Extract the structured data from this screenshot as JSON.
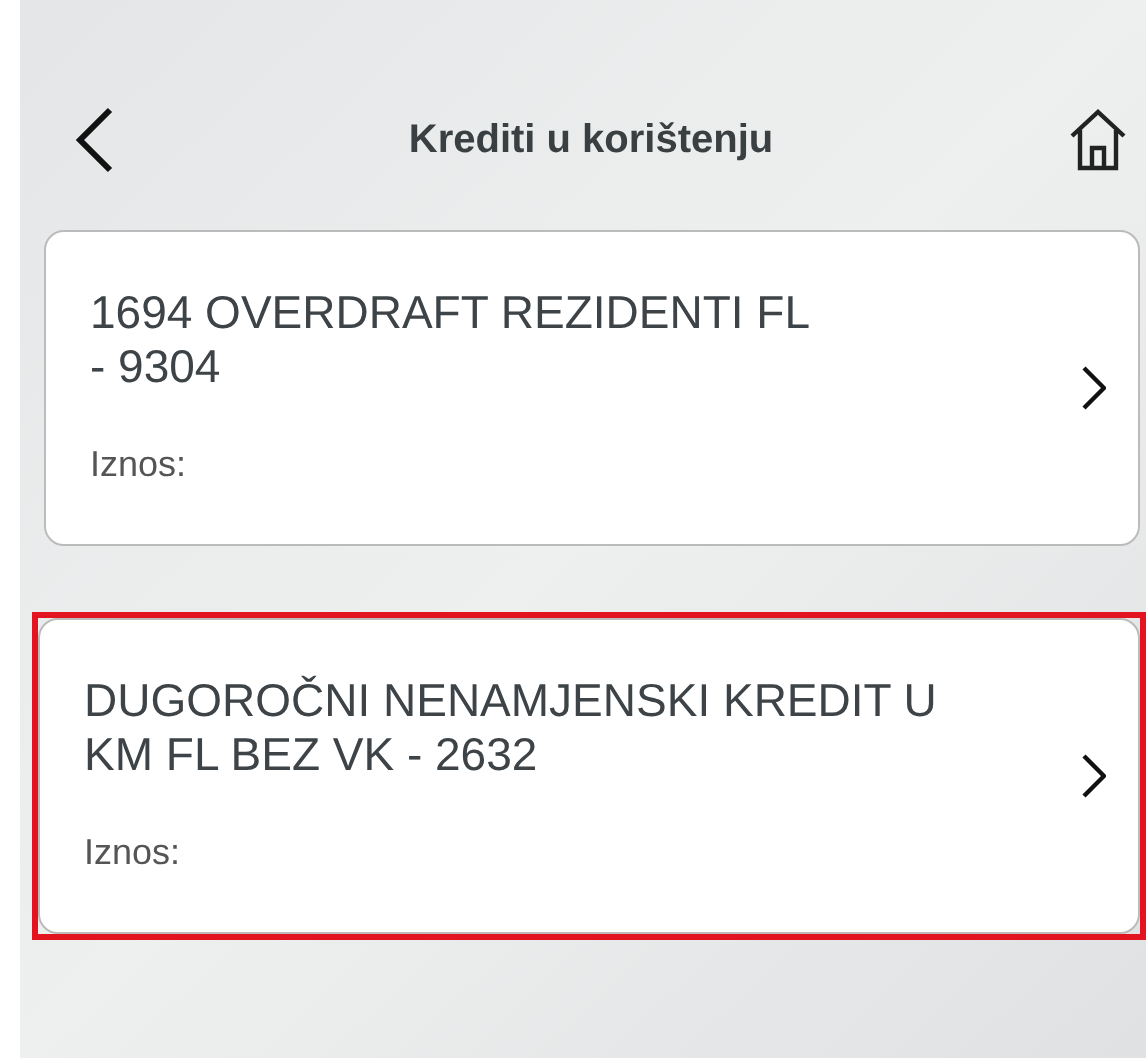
{
  "header": {
    "title": "Krediti u korištenju"
  },
  "loans": [
    {
      "name": "1694 OVERDRAFT REZIDENTI FL\n- 9304",
      "amount_label": "Iznos:",
      "highlighted": false
    },
    {
      "name": "DUGOROČNI NENAMJENSKI KREDIT U\nKM FL BEZ VK - 2632",
      "amount_label": "Iznos:",
      "highlighted": true
    }
  ]
}
